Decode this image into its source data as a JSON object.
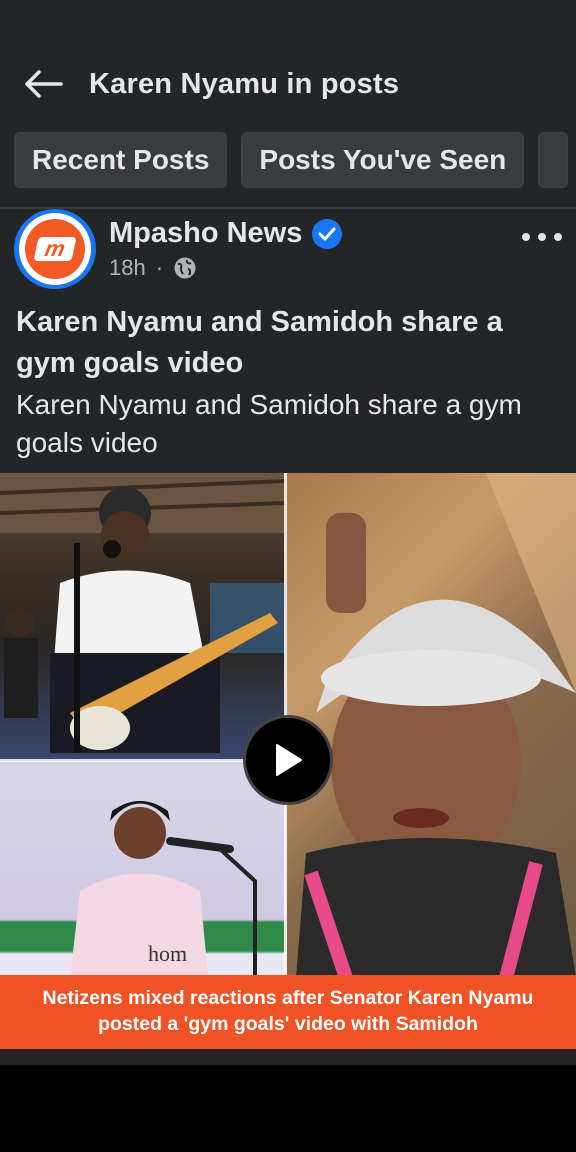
{
  "header": {
    "title": "Karen Nyamu in posts",
    "back_icon": "arrow-left-icon"
  },
  "filters": {
    "chips": [
      "Recent Posts",
      "Posts You've Seen"
    ]
  },
  "post": {
    "page_name": "Mpasho News",
    "time": "18h",
    "separator": "·",
    "privacy_icon": "globe-icon",
    "verified_icon": "verified-badge-icon",
    "more_icon": "more-options-icon",
    "title": "Karen Nyamu and Samidoh share a gym goals video",
    "description": "Karen Nyamu and Samidoh share a gym goals video",
    "media": {
      "banner_line1": "Netizens mixed reactions after Senator Karen Nyamu",
      "banner_line2_pre": "posted a 'gym goals' video with Samidoh",
      "play_icon": "play-icon"
    }
  },
  "colors": {
    "background": "#242526",
    "text": "#e4e6eb",
    "secondary_text": "#b0b3b8",
    "accent": "#1877f2",
    "banner": "#ef5224",
    "brand": "#f15a24"
  }
}
